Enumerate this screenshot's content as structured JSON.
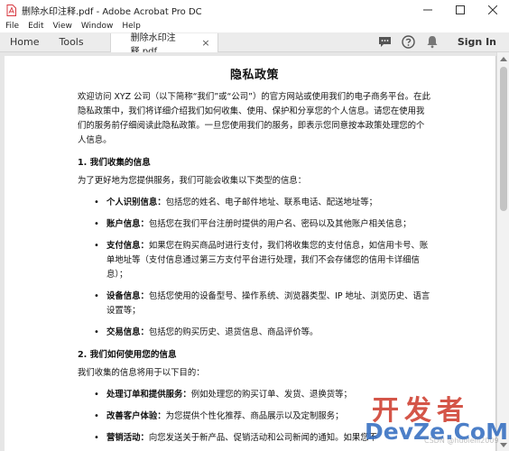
{
  "window": {
    "title": "删除水印注释.pdf - Adobe Acrobat Pro DC"
  },
  "menu": {
    "items": [
      "File",
      "Edit",
      "View",
      "Window",
      "Help"
    ]
  },
  "tabs": {
    "home": "Home",
    "tools": "Tools",
    "document": "删除水印注释.pdf",
    "close_symbol": "×",
    "sign_in": "Sign In"
  },
  "document": {
    "title": "隐私政策",
    "intro": "欢迎访问 XYZ 公司（以下简称“我们”或“公司”）的官方网站或使用我们的电子商务平台。在此隐私政策中，我们将详细介绍我们如何收集、使用、保护和分享您的个人信息。请您在使用我们的服务前仔细阅读此隐私政策。一旦您使用我们的服务，即表示您同意按本政策处理您的个人信息。",
    "section1": {
      "heading": "1. 我们收集的信息",
      "lead": "为了更好地为您提供服务，我们可能会收集以下类型的信息：",
      "items": [
        {
          "label": "个人识别信息：",
          "text": "包括您的姓名、电子邮件地址、联系电话、配送地址等；"
        },
        {
          "label": "账户信息：",
          "text": "包括您在我们平台注册时提供的用户名、密码以及其他账户相关信息；"
        },
        {
          "label": "支付信息：",
          "text": "如果您在购买商品时进行支付，我们将收集您的支付信息，如信用卡号、账单地址等（支付信息通过第三方支付平台进行处理，我们不会存储您的信用卡详细信息）；"
        },
        {
          "label": "设备信息：",
          "text": "包括您使用的设备型号、操作系统、浏览器类型、IP 地址、浏览历史、语言设置等；"
        },
        {
          "label": "交易信息：",
          "text": "包括您的购买历史、退货信息、商品评价等。"
        }
      ]
    },
    "section2": {
      "heading": "2. 我们如何使用您的信息",
      "lead": "我们收集的信息将用于以下目的：",
      "items": [
        {
          "label": "处理订单和提供服务：",
          "text": "例如处理您的购买订单、发货、退换货等；"
        },
        {
          "label": "改善客户体验：",
          "text": "为您提供个性化推荐、商品展示以及定制服务；"
        },
        {
          "label": "营销活动：",
          "text": "向您发送关于新产品、促销活动和公司新闻的通知。如果您不"
        }
      ]
    }
  },
  "watermarks": {
    "csdn": "CSDN @huoleiii2009",
    "kaifazhe": "开发者",
    "devze": "DevZe.CoM"
  },
  "colors": {
    "acrobat_red": "#d7373f",
    "tab_bar": "#ececec",
    "watermark_red": "#cd3728",
    "watermark_blue": "#2d69be"
  }
}
